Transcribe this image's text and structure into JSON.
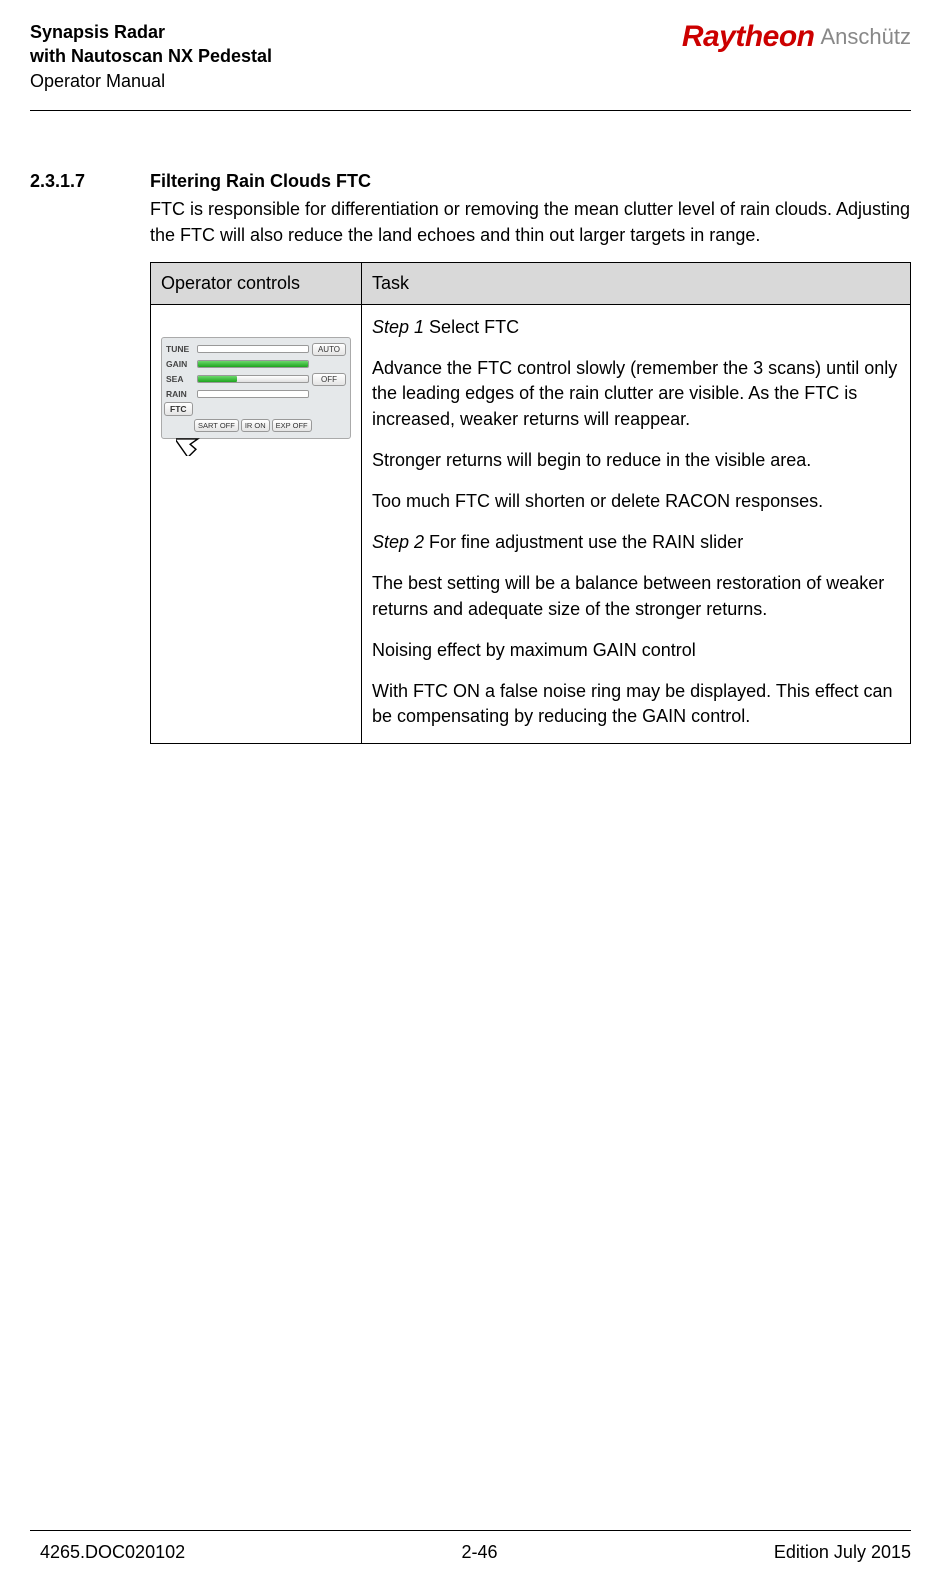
{
  "header": {
    "title_line1": "Synapsis Radar",
    "title_line2": "with Nautoscan NX Pedestal",
    "title_line3": "Operator Manual",
    "logo_raytheon": "Raytheon",
    "logo_anschutz": "Anschütz"
  },
  "section": {
    "number": "2.3.1.7",
    "title": "Filtering Rain Clouds FTC",
    "intro": "FTC is responsible for differentiation or removing the mean clutter level of rain clouds. Adjusting the FTC will also reduce the land echoes and thin out larger targets in range."
  },
  "table": {
    "col1": "Operator controls",
    "col2": "Task",
    "panel": {
      "rows": [
        "TUNE",
        "GAIN",
        "SEA",
        "RAIN"
      ],
      "btn_auto": "AUTO",
      "btn_off": "OFF",
      "ftc_label": "FTC",
      "bottom": [
        "SART OFF",
        "IR ON",
        "EXP OFF"
      ]
    },
    "task": {
      "step1_label": "Step 1",
      "step1_rest": " Select FTC",
      "p1": "Advance the FTC control slowly (remember the 3 scans) until only the leading edges of the rain clutter are visible. As the FTC is increased, weaker returns will reappear.",
      "p2": "Stronger returns will begin to reduce in the visible area.",
      "p3": "Too much FTC will shorten or delete RACON responses.",
      "step2_label": "Step 2",
      "step2_rest": " For fine adjustment use the RAIN slider",
      "p4": "The best setting will be a balance between restoration of weaker returns and adequate size of the stronger returns.",
      "p5": "Noising effect by maximum GAIN control",
      "p6": "With FTC ON a false noise ring may be displayed. This effect can be compensating by reducing the GAIN control."
    }
  },
  "footer": {
    "left": "4265.DOC020102",
    "center": "2-46",
    "right": "Edition July 2015"
  }
}
